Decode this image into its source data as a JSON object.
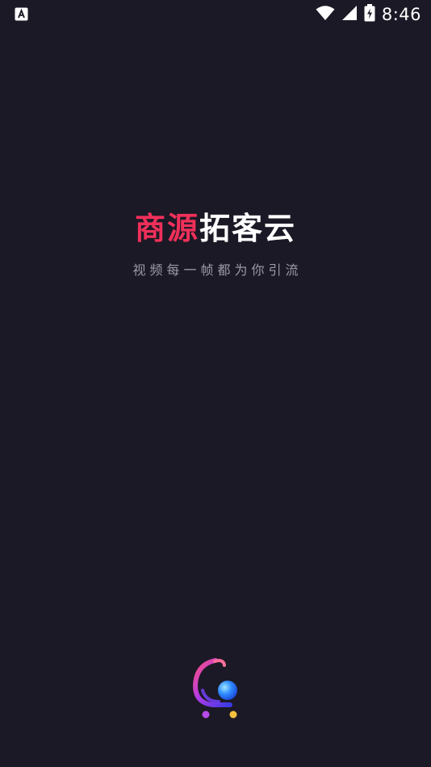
{
  "status_bar": {
    "notification_icon": "app-notification-icon",
    "wifi_icon": "wifi-icon",
    "signal_icon": "cell-signal-icon",
    "battery_icon": "battery-charging-icon",
    "time": "8:46"
  },
  "splash": {
    "brand_part1": "商源",
    "brand_part2": "拓客云",
    "slogan": "视频每一帧都为你引流",
    "accent_color": "#f0305a",
    "background_color": "#1b1925"
  },
  "logo": {
    "icon": "app-logo-icon"
  }
}
